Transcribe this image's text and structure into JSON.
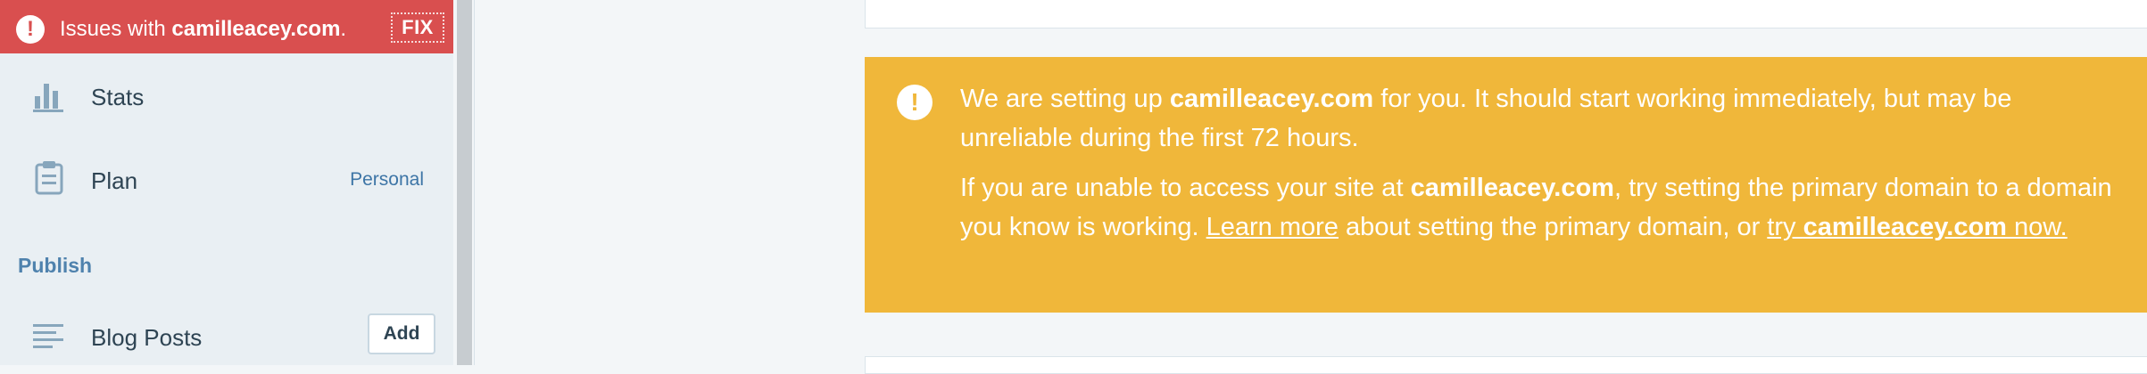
{
  "issues_bar": {
    "prefix": "Issues with ",
    "domain": "camilleacey.com",
    "suffix": ".",
    "fix_label": "FIX"
  },
  "sidebar": {
    "items": [
      {
        "label": "Stats",
        "icon": "stats-icon"
      },
      {
        "label": "Plan",
        "meta": "Personal",
        "icon": "clipboard-icon"
      }
    ],
    "section": "Publish",
    "publish_items": [
      {
        "label": "Blog Posts",
        "action": "Add",
        "icon": "posts-icon"
      }
    ]
  },
  "notice": {
    "icon": "alert-icon",
    "p1_a": "We are setting up ",
    "p1_domain": "camilleacey.com",
    "p1_b": " for you. It should start working immediately, but may be unreliable during the first 72 hours.",
    "p2_a": "If you are unable to access your site at ",
    "p2_domain": "camilleacey.com",
    "p2_b": ", try setting the primary domain to a domain you know is working. ",
    "learn_more": "Learn more",
    "p2_c": " about setting the primary domain, or ",
    "try_prefix": "try ",
    "try_domain": "camilleacey.com",
    "try_suffix": " now."
  },
  "colors": {
    "issues_bg": "#d94f4f",
    "notice_bg": "#f0b73a",
    "sidebar_bg": "#e9eff3",
    "accent": "#3d75a6"
  }
}
